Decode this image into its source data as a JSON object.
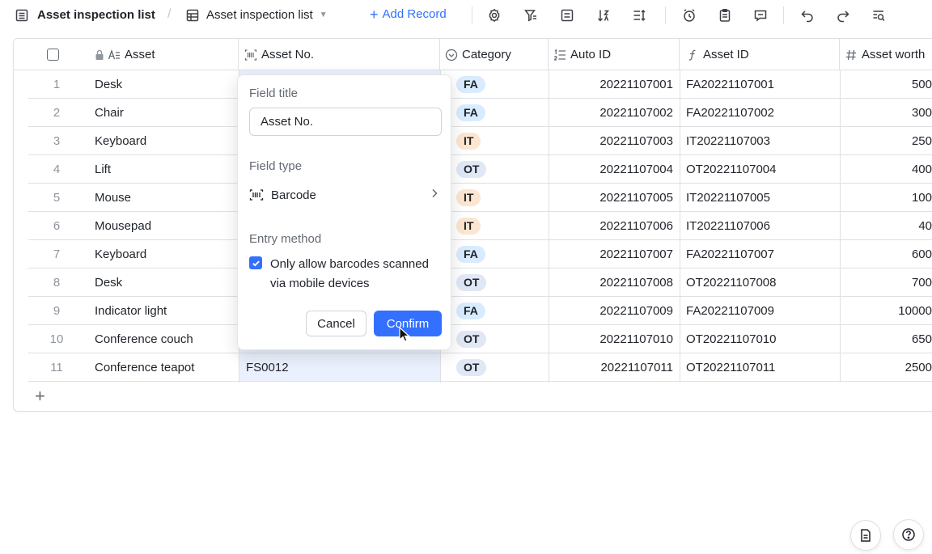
{
  "toolbar": {
    "table_title": "Asset inspection list",
    "view_name": "Asset inspection list",
    "add_record_label": "Add Record",
    "icons": [
      "settings-icon",
      "filter-icon",
      "group-icon",
      "sort-icon",
      "row-height-icon",
      "clock-icon",
      "clipboard-icon",
      "comment-icon",
      "undo-icon",
      "redo-icon",
      "search-icon"
    ]
  },
  "columns": [
    {
      "label": "Asset",
      "icon": "text-icon"
    },
    {
      "label": "Asset No.",
      "icon": "barcode-icon"
    },
    {
      "label": "Category",
      "icon": "single-select-icon"
    },
    {
      "label": "Auto ID",
      "icon": "auto-number-icon"
    },
    {
      "label": "Asset ID",
      "icon": "formula-icon"
    },
    {
      "label": "Asset worth",
      "icon": "number-icon"
    }
  ],
  "rows": [
    {
      "n": "1",
      "asset": "Desk",
      "asset_no": "",
      "category": "FA",
      "auto_id": "20221107001",
      "asset_id": "FA20221107001",
      "worth": "500"
    },
    {
      "n": "2",
      "asset": "Chair",
      "asset_no": "",
      "category": "FA",
      "auto_id": "20221107002",
      "asset_id": "FA20221107002",
      "worth": "300"
    },
    {
      "n": "3",
      "asset": "Keyboard",
      "asset_no": "",
      "category": "IT",
      "auto_id": "20221107003",
      "asset_id": "IT20221107003",
      "worth": "250"
    },
    {
      "n": "4",
      "asset": "Lift",
      "asset_no": "",
      "category": "OT",
      "auto_id": "20221107004",
      "asset_id": "OT20221107004",
      "worth": "400"
    },
    {
      "n": "5",
      "asset": "Mouse",
      "asset_no": "",
      "category": "IT",
      "auto_id": "20221107005",
      "asset_id": "IT20221107005",
      "worth": "100"
    },
    {
      "n": "6",
      "asset": "Mousepad",
      "asset_no": "",
      "category": "IT",
      "auto_id": "20221107006",
      "asset_id": "IT20221107006",
      "worth": "40"
    },
    {
      "n": "7",
      "asset": "Keyboard",
      "asset_no": "",
      "category": "FA",
      "auto_id": "20221107007",
      "asset_id": "FA20221107007",
      "worth": "600"
    },
    {
      "n": "8",
      "asset": "Desk",
      "asset_no": "",
      "category": "OT",
      "auto_id": "20221107008",
      "asset_id": "OT20221107008",
      "worth": "700"
    },
    {
      "n": "9",
      "asset": "Indicator light",
      "asset_no": "",
      "category": "FA",
      "auto_id": "20221107009",
      "asset_id": "FA20221107009",
      "worth": "10000"
    },
    {
      "n": "10",
      "asset": "Conference couch",
      "asset_no": "",
      "category": "OT",
      "auto_id": "20221107010",
      "asset_id": "OT20221107010",
      "worth": "650"
    },
    {
      "n": "11",
      "asset": "Conference teapot",
      "asset_no": "FS0012",
      "category": "OT",
      "auto_id": "20221107011",
      "asset_id": "OT20221107011",
      "worth": "2500"
    }
  ],
  "popup": {
    "field_title_label": "Field title",
    "field_title_value": "Asset No.",
    "field_type_label": "Field type",
    "field_type_value": "Barcode",
    "entry_method_label": "Entry method",
    "checkbox_label": "Only allow barcodes scanned via mobile devices",
    "checkbox_checked": true,
    "cancel_label": "Cancel",
    "confirm_label": "Confirm"
  },
  "colors": {
    "accent": "#3370ff",
    "tag_FA": "#d9ebff",
    "tag_IT": "#fde6cf",
    "tag_OT": "#e0e7f5"
  }
}
